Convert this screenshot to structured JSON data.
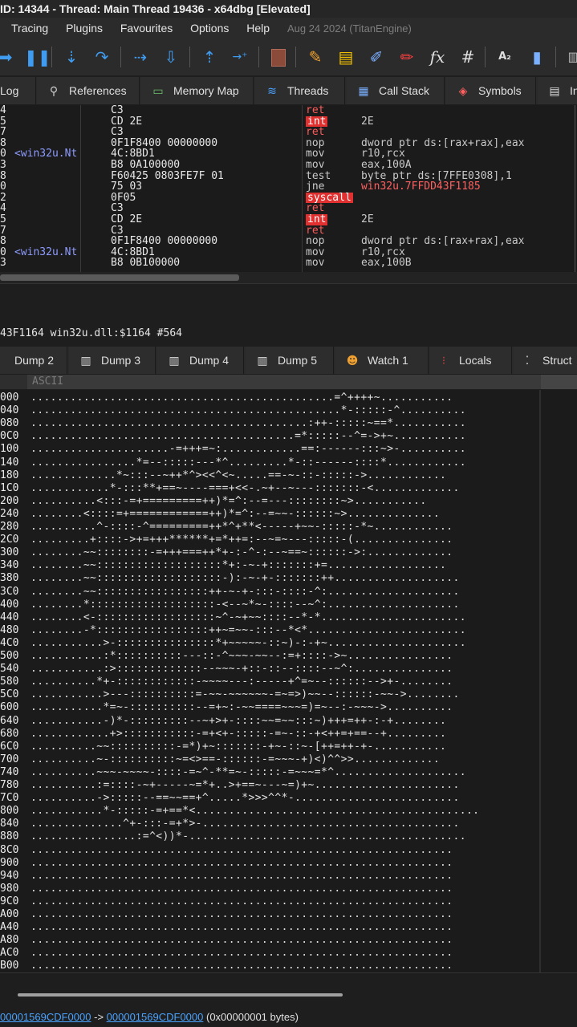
{
  "window": {
    "title": "ID: 14344 - Thread: Main Thread 19436 - x64dbg [Elevated]"
  },
  "menu": {
    "items": [
      "Tracing",
      "Plugins",
      "Favourites",
      "Options",
      "Help"
    ],
    "build_date": "Aug 24 2024 (TitanEngine)"
  },
  "toolbar": {
    "icons": [
      "run-to-user-icon",
      "pause-icon",
      "step-into-icon",
      "step-over-icon",
      "trace-into-icon",
      "trace-over-icon",
      "execute-till-return-icon",
      "run-to-user-code-icon",
      "scylla-icon",
      "highlight-icon",
      "patch-icon",
      "comment-icon",
      "label-icon",
      "function-icon",
      "hash-icon",
      "font-icon",
      "bookmark-icon",
      "calculator-icon"
    ],
    "fx_label": "fx",
    "hash_label": "#",
    "font_label": "A₂"
  },
  "tabs_top": [
    {
      "label": "Log",
      "icon": "log-icon"
    },
    {
      "label": "References",
      "icon": "references-icon"
    },
    {
      "label": "Memory Map",
      "icon": "memory-map-icon"
    },
    {
      "label": "Threads",
      "icon": "threads-icon"
    },
    {
      "label": "Call Stack",
      "icon": "call-stack-icon"
    },
    {
      "label": "Symbols",
      "icon": "symbols-icon"
    },
    {
      "label": "In",
      "icon": "info-icon"
    }
  ],
  "disasm": {
    "rows": [
      {
        "a": "4",
        "b": "",
        "c": "C3",
        "m": "ret",
        "o": "",
        "mstyle": "red",
        "ostyle": ""
      },
      {
        "a": "5",
        "b": "",
        "c": "CD 2E",
        "m": "int",
        "o": "2E",
        "mstyle": "redbg",
        "ostyle": ""
      },
      {
        "a": "7",
        "b": "",
        "c": "C3",
        "m": "ret",
        "o": "",
        "mstyle": "red",
        "ostyle": ""
      },
      {
        "a": "8",
        "b": "",
        "c": "0F1F8400 00000000",
        "m": "nop",
        "o": "dword ptr ds:[rax+rax],eax",
        "mstyle": "",
        "ostyle": ""
      },
      {
        "a": "0",
        "b": "<win32u.Nt",
        "c": "4C:8BD1",
        "m": "mov",
        "o": "r10,rcx",
        "mstyle": "",
        "ostyle": ""
      },
      {
        "a": "3",
        "b": "",
        "c": "B8 0A100000",
        "m": "mov",
        "o": "eax,100A",
        "mstyle": "",
        "ostyle": ""
      },
      {
        "a": "8",
        "b": "",
        "c": "F60425 0803FE7F 01",
        "m": "test",
        "o": "byte ptr ds:[7FFE0308],1",
        "mstyle": "",
        "ostyle": ""
      },
      {
        "a": "0",
        "b": "",
        "c": "75 03",
        "m": "jne",
        "o": "win32u.7FFDD43F1185",
        "mstyle": "",
        "ostyle": "redtxt"
      },
      {
        "a": "2",
        "b": "",
        "c": "0F05",
        "m": "syscall",
        "o": "",
        "mstyle": "redbg",
        "ostyle": ""
      },
      {
        "a": "4",
        "b": "",
        "c": "C3",
        "m": "ret",
        "o": "",
        "mstyle": "red",
        "ostyle": ""
      },
      {
        "a": "5",
        "b": "",
        "c": "CD 2E",
        "m": "int",
        "o": "2E",
        "mstyle": "redbg",
        "ostyle": ""
      },
      {
        "a": "7",
        "b": "",
        "c": "C3",
        "m": "ret",
        "o": "",
        "mstyle": "red",
        "ostyle": ""
      },
      {
        "a": "8",
        "b": "",
        "c": "0F1F8400 00000000",
        "m": "nop",
        "o": "dword ptr ds:[rax+rax],eax",
        "mstyle": "",
        "ostyle": ""
      },
      {
        "a": "0",
        "b": "<win32u.Nt",
        "c": "4C:8BD1",
        "m": "mov",
        "o": "r10,rcx",
        "mstyle": "",
        "ostyle": ""
      },
      {
        "a": "3",
        "b": "",
        "c": "B8 0B100000",
        "m": "mov",
        "o": "eax,100B",
        "mstyle": "",
        "ostyle": ""
      }
    ]
  },
  "address_info": "43F1164 win32u.dll:$1164 #564",
  "tabs_dump": [
    {
      "label": "Dump 2",
      "icon": "dump-icon"
    },
    {
      "label": "Dump 3",
      "icon": "dump-icon"
    },
    {
      "label": "Dump 4",
      "icon": "dump-icon"
    },
    {
      "label": "Dump 5",
      "icon": "dump-icon"
    },
    {
      "label": "Watch 1",
      "icon": "watch-icon"
    },
    {
      "label": "Locals",
      "icon": "locals-icon"
    },
    {
      "label": "Struct",
      "icon": "struct-icon"
    }
  ],
  "dump": {
    "header": "ASCII",
    "rows": [
      {
        "addr": "000",
        "ascii": "..............................................=^++++~..........."
      },
      {
        "addr": "040",
        "ascii": "...............................................*-:::::-^.........."
      },
      {
        "addr": "080",
        "ascii": "..........................................:++-:::::~==*..........."
      },
      {
        "addr": "0C0",
        "ascii": "........................................=*:::::--^=->+~..........."
      },
      {
        "addr": "100",
        "ascii": ".....................-=+++=~:............==:------:::~>-.........."
      },
      {
        "addr": "140",
        "ascii": "................*=--:::::---*^.........*-::------::::*............"
      },
      {
        "addr": "180",
        "ascii": ".............*~:::--~++*^><<^<~.....==-~-::-:::::->............"
      },
      {
        "addr": "1C0",
        "ascii": "............*-:::**+==~----===+<<-.~+--~---:::::::-<............."
      },
      {
        "addr": "200",
        "ascii": "..........<:::-=+=========++)*=^:--=---::::::::~>..........."
      },
      {
        "addr": "240",
        "ascii": "........<::::=+============++)*=^:--=~~-::::::~>.............."
      },
      {
        "addr": "280",
        "ascii": "..........^-::::-^=========++*^+**<-----+~~-:::::-*~............"
      },
      {
        "addr": "2C0",
        "ascii": ".........+::::->+=+++******+=*++=:--~=~---:::::-(..............."
      },
      {
        "addr": "300",
        "ascii": "........~~::::::::-=+++===++*+-:-^-:--~==~::::::->:............."
      },
      {
        "addr": "340",
        "ascii": "........~~:::::::::::::::::::*+:-~-+:::::::+=.................."
      },
      {
        "addr": "380",
        "ascii": "........~~:::::::::::::::::::-):-~-+-:::::::++..................."
      },
      {
        "addr": "3C0",
        "ascii": "........~~:::::::::::::::::++-~-+-:::-::::-^:...................."
      },
      {
        "addr": "400",
        "ascii": "........*:::::::::::::::::::-<--~*~-::::--~^:...................."
      },
      {
        "addr": "440",
        "ascii": "........<-::::::::::::::::::~^-~+~~::::--*-*......................"
      },
      {
        "addr": "480",
        "ascii": "........-*:::::::::::::::::++~=~~-:::--*<*........................"
      },
      {
        "addr": "4C0",
        "ascii": "...........>-:::::::::::::::*+~~~~~-::~)-:-+~....................."
      },
      {
        "addr": "500",
        "ascii": "...........:*::::::::::---::-^~~~-~~--:=+::::->~................"
      },
      {
        "addr": "540",
        "ascii": "...........:>:::::::::::::--~~~-+::-::--::::--~^:..............."
      },
      {
        "addr": "580",
        "ascii": "..........*+-::::::::::::-~~~~---:-----+^=~--::::::-->+-........"
      },
      {
        "addr": "5C0",
        "ascii": "...........>---::::::::::=-~~-~~~~~~-=~=>)~~--::::::-~~->........"
      },
      {
        "addr": "600",
        "ascii": "...........*=~-::::::::::--=+~:-~~====~~~=)=~--:-~~~->.........."
      },
      {
        "addr": "640",
        "ascii": "...........-)*-:::::::::--~+>+-::::~~=~~:::~)+++=++-:-+........"
      },
      {
        "addr": "680",
        "ascii": "............+>:::::::::::-=+<+-:::::-=~-::-+<++=+==--+........."
      },
      {
        "addr": "6C0",
        "ascii": "..........~~::::::::::-=*)+~:::::::-+~-::~-[++=++-+-..........."
      },
      {
        "addr": "700",
        "ascii": "..........~-::::::::::~=<>==-::::::-=~~~-+)<)^^>>............."
      },
      {
        "addr": "740",
        "ascii": "..........~~~-~~~~-::::-=~^-**=~-:::::-=~~~=*^...................."
      },
      {
        "addr": "780",
        "ascii": "..........:=::::-~+-----~=*+..>+==~---~=)+~......................"
      },
      {
        "addr": "7C0",
        "ascii": "..........->:::::--==~~==+^.....*>>>^^*-........................."
      },
      {
        "addr": "800",
        "ascii": "...........*-:::::-=+==*<..........................................."
      },
      {
        "addr": "840",
        "ascii": "..............^+-:::-=+*>-......................................."
      },
      {
        "addr": "880",
        "ascii": "................:=^<))*-.........................................."
      },
      {
        "addr": "8C0",
        "ascii": "................................................................"
      },
      {
        "addr": "900",
        "ascii": "................................................................"
      },
      {
        "addr": "940",
        "ascii": "................................................................"
      },
      {
        "addr": "980",
        "ascii": "................................................................"
      },
      {
        "addr": "9C0",
        "ascii": "................................................................"
      },
      {
        "addr": "A00",
        "ascii": "................................................................"
      },
      {
        "addr": "A40",
        "ascii": "................................................................"
      },
      {
        "addr": "A80",
        "ascii": "................................................................"
      },
      {
        "addr": "AC0",
        "ascii": "................................................................"
      },
      {
        "addr": "B00",
        "ascii": "................................................................"
      }
    ]
  },
  "status": {
    "from_addr": "00001569CDF0000",
    "arrow": "->",
    "to_addr": "000001569CDF0000",
    "size": "(0x00000001 bytes)"
  }
}
